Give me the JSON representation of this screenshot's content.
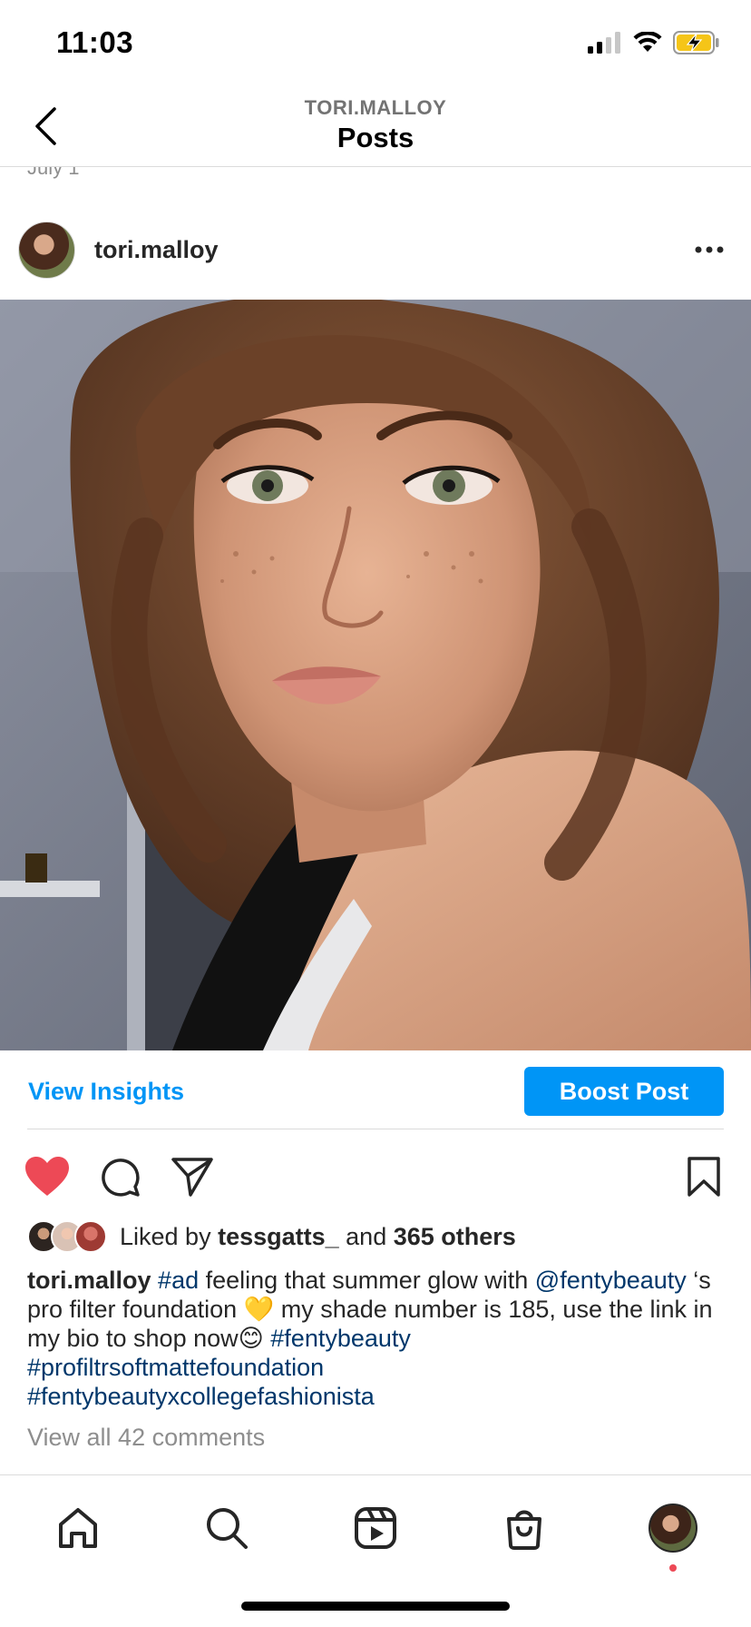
{
  "status_bar": {
    "time": "11:03"
  },
  "header": {
    "subtitle": "TORI.MALLOY",
    "title": "Posts"
  },
  "previous_post_date": "July 1",
  "post": {
    "username": "tori.malloy",
    "photo_description_icon": "selfie-photo",
    "view_insights_label": "View Insights",
    "boost_label": "Boost Post",
    "liked": true,
    "likes": {
      "prefix": "Liked by ",
      "user": "tessgatts_",
      "middle": " and ",
      "others": "365 others"
    },
    "caption": {
      "user": "tori.malloy",
      "tag_ad": "#ad",
      "text1": " feeling that summer glow with ",
      "mention": "@fentybeauty",
      "text2": " ‘s pro filter foundation 💛 my shade number is 185, use the link in my bio to shop now😊 ",
      "tag1": "#fentybeauty",
      "tag2": "#profiltrsoftmattefoundation",
      "tag3": "#fentybeautyxcollegefashionista"
    },
    "view_comments": "View all 42 comments"
  },
  "colors": {
    "accent": "#0095f6",
    "like": "#ed4956",
    "hashtag": "#00376b"
  },
  "tab_bar": {
    "icons": [
      "home-icon",
      "search-icon",
      "reels-icon",
      "shop-icon",
      "profile-avatar"
    ]
  }
}
